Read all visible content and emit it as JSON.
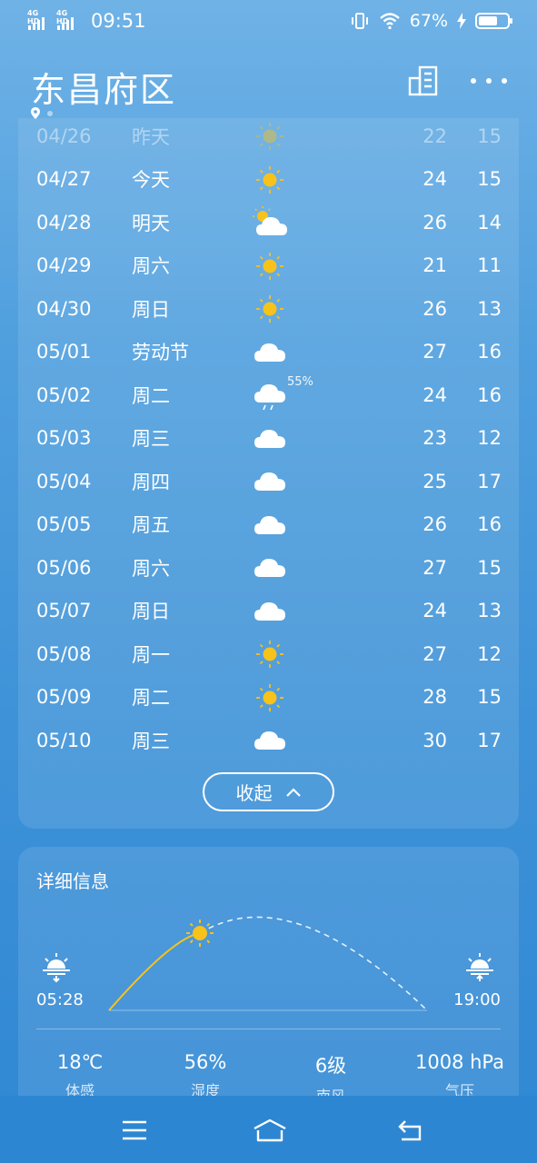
{
  "status": {
    "sim1": "4G HD",
    "sim2": "4G HD",
    "time": "09:51",
    "battery_pct": "67%",
    "battery_level": 0.67
  },
  "header": {
    "city": "东昌府区"
  },
  "forecast": [
    {
      "date": "04/26",
      "day": "昨天",
      "icon": "sunny-icon",
      "pop": "",
      "hi": "22",
      "lo": "15",
      "faded": true
    },
    {
      "date": "04/27",
      "day": "今天",
      "icon": "sunny-icon",
      "pop": "",
      "hi": "24",
      "lo": "15"
    },
    {
      "date": "04/28",
      "day": "明天",
      "icon": "partly-cloudy-icon",
      "pop": "",
      "hi": "26",
      "lo": "14"
    },
    {
      "date": "04/29",
      "day": "周六",
      "icon": "sunny-icon",
      "pop": "",
      "hi": "21",
      "lo": "11"
    },
    {
      "date": "04/30",
      "day": "周日",
      "icon": "sunny-icon",
      "pop": "",
      "hi": "26",
      "lo": "13"
    },
    {
      "date": "05/01",
      "day": "劳动节",
      "icon": "cloudy-icon",
      "pop": "",
      "hi": "27",
      "lo": "16"
    },
    {
      "date": "05/02",
      "day": "周二",
      "icon": "rain-icon",
      "pop": "55%",
      "hi": "24",
      "lo": "16"
    },
    {
      "date": "05/03",
      "day": "周三",
      "icon": "cloudy-icon",
      "pop": "",
      "hi": "23",
      "lo": "12"
    },
    {
      "date": "05/04",
      "day": "周四",
      "icon": "cloudy-icon",
      "pop": "",
      "hi": "25",
      "lo": "17"
    },
    {
      "date": "05/05",
      "day": "周五",
      "icon": "cloudy-icon",
      "pop": "",
      "hi": "26",
      "lo": "16"
    },
    {
      "date": "05/06",
      "day": "周六",
      "icon": "cloudy-icon",
      "pop": "",
      "hi": "27",
      "lo": "15"
    },
    {
      "date": "05/07",
      "day": "周日",
      "icon": "cloudy-icon",
      "pop": "",
      "hi": "24",
      "lo": "13"
    },
    {
      "date": "05/08",
      "day": "周一",
      "icon": "sunny-icon",
      "pop": "",
      "hi": "27",
      "lo": "12"
    },
    {
      "date": "05/09",
      "day": "周二",
      "icon": "sunny-icon",
      "pop": "",
      "hi": "28",
      "lo": "15"
    },
    {
      "date": "05/10",
      "day": "周三",
      "icon": "cloudy-icon",
      "pop": "",
      "hi": "30",
      "lo": "17"
    }
  ],
  "collapse_label": "收起",
  "details": {
    "title": "详细信息",
    "sunrise": "05:28",
    "sunset": "19:00",
    "feels_like": {
      "value": "18℃",
      "label": "体感"
    },
    "humidity": {
      "value": "56%",
      "label": "湿度"
    },
    "wind": {
      "value": "6级",
      "label": "南风"
    },
    "pressure": {
      "value": "1008 hPa",
      "label": "气压"
    }
  },
  "colors": {
    "sun": "#f7c21a",
    "bg_top": "#6fb2e6",
    "bg_bottom": "#2f87d3"
  }
}
